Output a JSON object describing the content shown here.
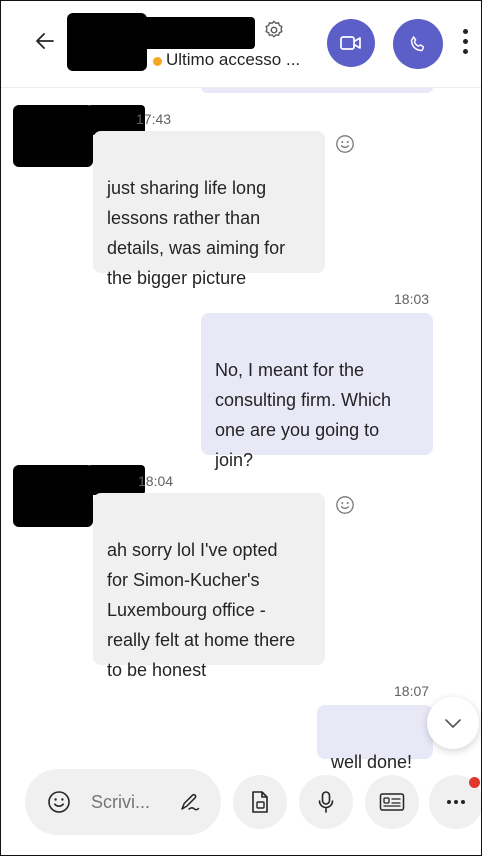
{
  "header": {
    "status_text": "Ultimo accesso ...",
    "status_color": "#f5a623",
    "accent_color": "#5b5fc7",
    "icons": [
      "back-arrow-icon",
      "settings-gear-icon",
      "video-call-icon",
      "phone-call-icon",
      "more-options-icon"
    ]
  },
  "messages": [
    {
      "direction": "incoming",
      "time": "17:43",
      "text": "just sharing life long\nlessons rather than\ndetails, was aiming for\nthe bigger picture"
    },
    {
      "direction": "outgoing",
      "time": "18:03",
      "text": "No, I meant for the\nconsulting firm. Which\none are you going to\njoin?"
    },
    {
      "direction": "incoming",
      "time": "18:04",
      "text": "ah sorry lol I've opted\nfor Simon-Kucher's\nLuxembourg office -\nreally felt at home there\nto be honest"
    },
    {
      "direction": "outgoing",
      "time": "18:07",
      "text": "well done!"
    }
  ],
  "composer": {
    "placeholder": "Scrivi...",
    "icons": [
      "emoji-icon",
      "format-pen-icon",
      "attach-file-icon",
      "microphone-icon",
      "contact-card-icon",
      "more-actions-icon"
    ],
    "notification_color": "#e0392b"
  }
}
